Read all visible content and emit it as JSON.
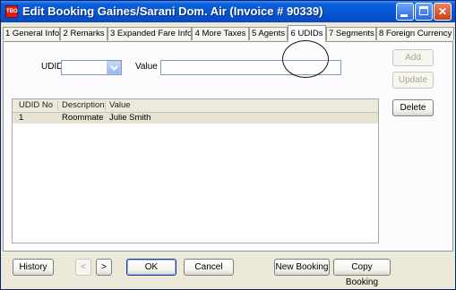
{
  "window": {
    "title": "Edit Booking Gaines/Sarani  Dom. Air (Invoice # 90339)",
    "app_icon_text": "TBO"
  },
  "tabs": [
    {
      "label": "1 General Info"
    },
    {
      "label": "2 Remarks"
    },
    {
      "label": "3 Expanded Fare Info"
    },
    {
      "label": "4 More Taxes"
    },
    {
      "label": "5 Agents"
    },
    {
      "label": "6 UDIDs"
    },
    {
      "label": "7 Segments"
    },
    {
      "label": "8 Foreign Currency"
    }
  ],
  "form": {
    "udid_label": "UDID",
    "udid_value": "",
    "value_label": "Value",
    "value_input": ""
  },
  "grid": {
    "headers": [
      "UDID No",
      "Description",
      "Value"
    ],
    "rows": [
      {
        "udid_no": "1",
        "description": "Roommate",
        "value": "Julie Smith"
      }
    ]
  },
  "side_buttons": {
    "add": "Add",
    "update": "Update",
    "delete": "Delete"
  },
  "bottom_buttons": {
    "history": "History",
    "prev": "<",
    "next": ">",
    "ok": "OK",
    "cancel": "Cancel",
    "new_booking": "New Booking",
    "copy_booking": "Copy Booking"
  },
  "icons": {
    "app": "travel-booking-app-icon",
    "dropdown": "chevron-down-icon"
  }
}
